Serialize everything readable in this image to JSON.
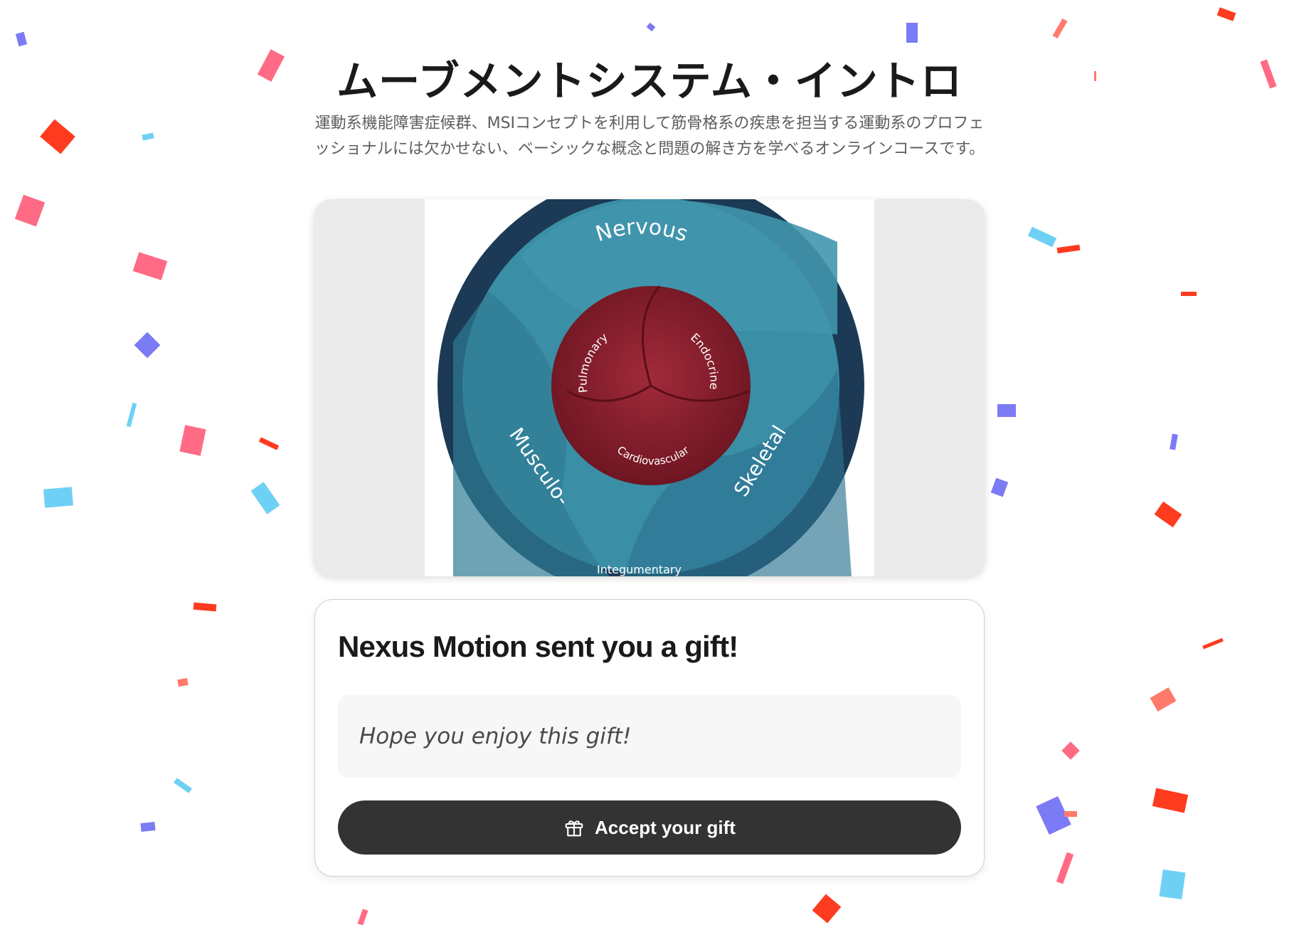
{
  "course": {
    "title": "ムーブメントシステム・イントロ",
    "description": "運動系機能障害症候群、MSIコンセプトを利用して筋骨格系の疾患を担当する運動系のプロフェッショナルには欠かせない、ベーシックな概念と問題の解き方を学べるオンラインコースです。"
  },
  "hero_image": {
    "outer_labels": [
      "Nervous",
      "Musculo-",
      "Skeletal",
      "Integumentary"
    ],
    "inner_labels": [
      "Pulmonary",
      "Endocrine",
      "Cardiovascular"
    ]
  },
  "gift": {
    "heading": "Nexus Motion sent you a gift!",
    "message": "Hope you enjoy this gift!",
    "accept_label": "Accept your gift",
    "accept_icon": "gift-icon"
  },
  "colors": {
    "button_bg": "#333333",
    "wheel_outer_ring": "#1c3a55",
    "wheel_teal": "#3a8ea6",
    "wheel_inner_red": "#8b1e2c",
    "confetti": [
      "#ff3b1f",
      "#ff6b85",
      "#7b7bf5",
      "#6fd0f5",
      "#ff7a6b"
    ]
  }
}
